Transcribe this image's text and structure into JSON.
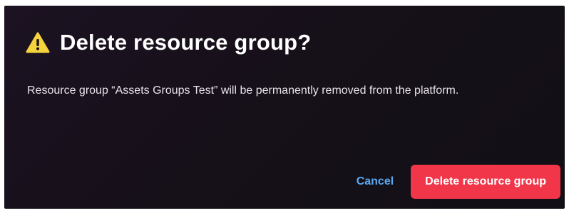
{
  "dialog": {
    "title": "Delete resource group?",
    "title_icon": "warning-icon",
    "message": "Resource group “Assets Groups Test” will be permanently removed from the platform.",
    "actions": {
      "cancel_label": "Cancel",
      "confirm_label": "Delete resource group"
    }
  },
  "colors": {
    "background": "#161019",
    "warning_icon": "#f5d33d",
    "cancel_text": "#5aa9f2",
    "confirm_button": "#f2364a",
    "title_text": "#ffffff"
  }
}
